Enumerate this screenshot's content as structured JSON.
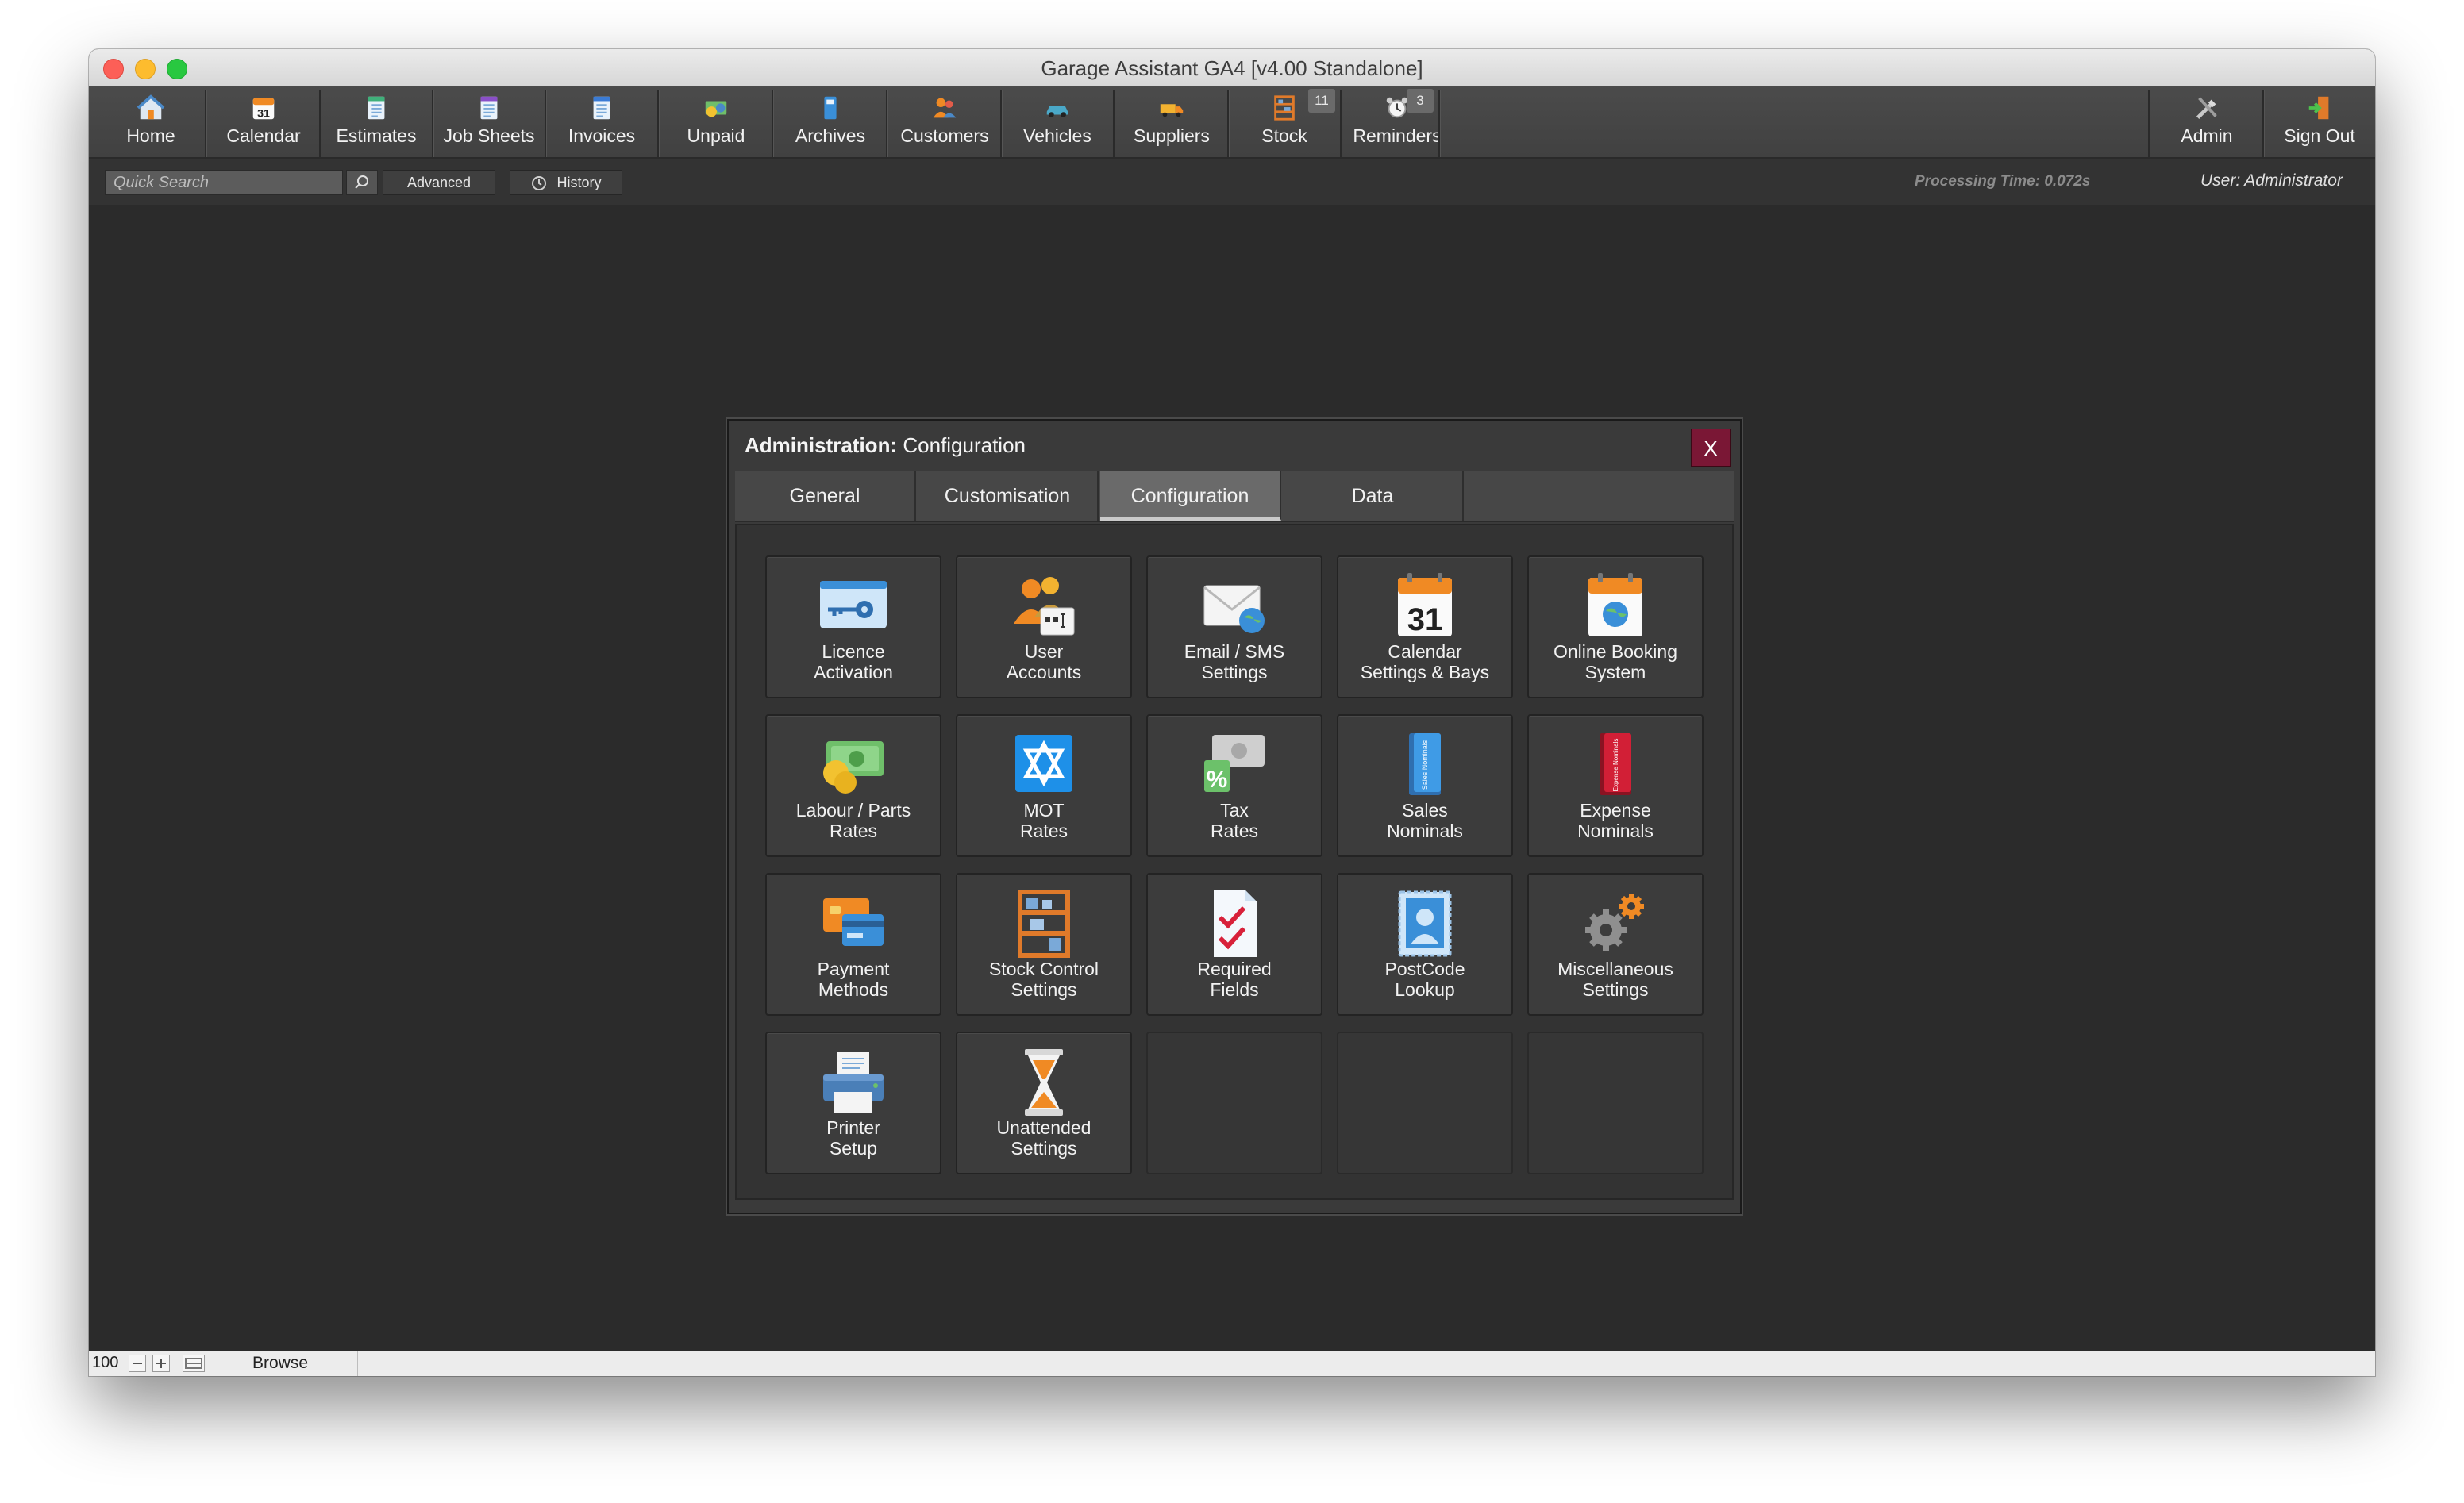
{
  "window": {
    "title": "Garage Assistant GA4 [v4.00 Standalone]"
  },
  "nav": {
    "items": [
      {
        "label": "Home",
        "icon": "home-icon"
      },
      {
        "label": "Calendar",
        "icon": "calendar-icon"
      },
      {
        "label": "Estimates",
        "icon": "estimates-icon"
      },
      {
        "label": "Job Sheets",
        "icon": "job-sheets-icon"
      },
      {
        "label": "Invoices",
        "icon": "invoices-icon"
      },
      {
        "label": "Unpaid",
        "icon": "unpaid-icon"
      },
      {
        "label": "Archives",
        "icon": "archives-icon"
      },
      {
        "label": "Customers",
        "icon": "customers-icon"
      },
      {
        "label": "Vehicles",
        "icon": "vehicles-icon"
      },
      {
        "label": "Suppliers",
        "icon": "suppliers-icon"
      },
      {
        "label": "Stock",
        "icon": "stock-icon",
        "badge": "11"
      },
      {
        "label": "Reminders",
        "icon": "reminders-icon",
        "badge": "3"
      },
      {
        "label": "Admin",
        "icon": "admin-icon"
      },
      {
        "label": "Sign Out",
        "icon": "sign-out-icon"
      }
    ]
  },
  "subbar": {
    "search_placeholder": "Quick Search",
    "advanced_label": "Advanced",
    "history_label": "History",
    "processing_time": "Processing Time: 0.072s",
    "user": "User: Administrator"
  },
  "dialog": {
    "title_bold": "Administration:",
    "title_rest": " Configuration",
    "close_label": "X",
    "tabs": [
      "General",
      "Customisation",
      "Configuration",
      "Data"
    ],
    "active_tab": "Configuration",
    "tiles": [
      {
        "line1": "Licence",
        "line2": "Activation",
        "icon": "licence-key-icon"
      },
      {
        "line1": "User",
        "line2": "Accounts",
        "icon": "user-accounts-icon"
      },
      {
        "line1": "Email / SMS",
        "line2": "Settings",
        "icon": "email-sms-icon"
      },
      {
        "line1": "Calendar",
        "line2": "Settings & Bays",
        "icon": "calendar-settings-icon",
        "icon_text": "31"
      },
      {
        "line1": "Online Booking",
        "line2": "System",
        "icon": "online-booking-icon"
      },
      {
        "line1": "Labour / Parts",
        "line2": "Rates",
        "icon": "labour-parts-rates-icon"
      },
      {
        "line1": "MOT",
        "line2": "Rates",
        "icon": "mot-rates-icon"
      },
      {
        "line1": "Tax",
        "line2": "Rates",
        "icon": "tax-rates-icon",
        "icon_text": "%"
      },
      {
        "line1": "Sales",
        "line2": "Nominals",
        "icon": "sales-nominals-icon",
        "icon_text": "Sales Nominals"
      },
      {
        "line1": "Expense",
        "line2": "Nominals",
        "icon": "expense-nominals-icon",
        "icon_text": "Expense Nominals"
      },
      {
        "line1": "Payment",
        "line2": "Methods",
        "icon": "payment-methods-icon"
      },
      {
        "line1": "Stock Control",
        "line2": "Settings",
        "icon": "stock-control-icon"
      },
      {
        "line1": "Required",
        "line2": "Fields",
        "icon": "required-fields-icon"
      },
      {
        "line1": "PostCode",
        "line2": "Lookup",
        "icon": "postcode-lookup-icon"
      },
      {
        "line1": "Miscellaneous",
        "line2": "Settings",
        "icon": "miscellaneous-settings-icon"
      },
      {
        "line1": "Printer",
        "line2": "Setup",
        "icon": "printer-icon"
      },
      {
        "line1": "Unattended",
        "line2": "Settings",
        "icon": "hourglass-icon"
      }
    ]
  },
  "statusbar": {
    "zoom": "100",
    "mode": "Browse"
  },
  "colors": {
    "close_button": "#7a1735",
    "background": "#2b2b2b",
    "toolbar": "#404040",
    "tile": "#3c3c3c"
  }
}
